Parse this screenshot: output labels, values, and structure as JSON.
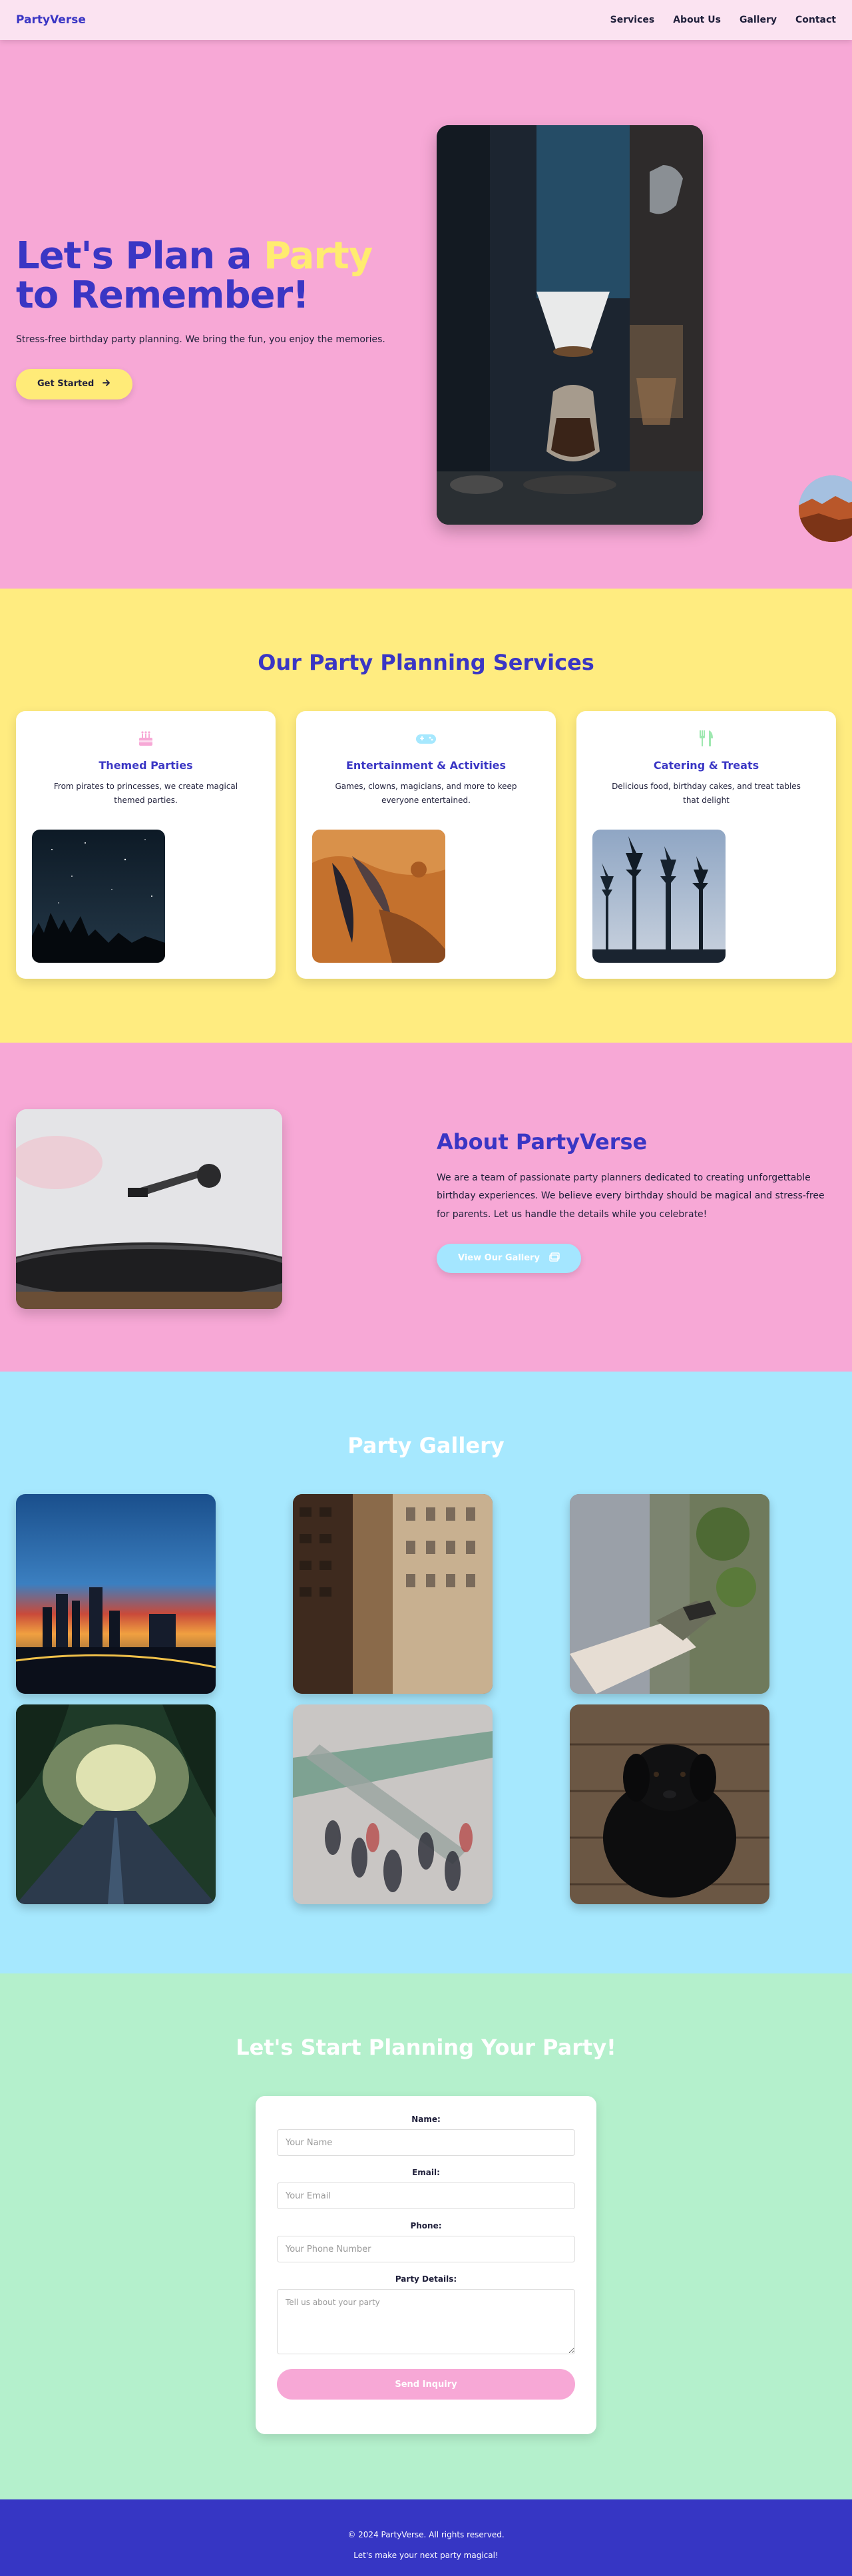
{
  "nav": {
    "logo": "PartyVerse",
    "links": [
      "Services",
      "About Us",
      "Gallery",
      "Contact"
    ]
  },
  "hero": {
    "title_part1": "Let's Plan a ",
    "title_highlight": "Party",
    "title_part2": " to Remember!",
    "subtitle": "Stress-free birthday party planning. We bring the fun, you enjoy the memories.",
    "cta_label": "Get Started",
    "cta_icon": "arrow-right-icon"
  },
  "services": {
    "title": "Our Party Planning Services",
    "items": [
      {
        "icon": "cake-icon",
        "title": "Themed Parties",
        "desc": "From pirates to princesses, we create magical themed parties."
      },
      {
        "icon": "gamepad-icon",
        "title": "Entertainment & Activities",
        "desc": "Games, clowns, magicians, and more to keep everyone entertained."
      },
      {
        "icon": "utensils-icon",
        "title": "Catering & Treats",
        "desc": "Delicious food, birthday cakes, and treat tables that delight"
      }
    ]
  },
  "about": {
    "title": "About PartyVerse",
    "body": "We are a team of passionate party planners dedicated to creating unforgettable birthday experiences. We believe every birthday should be magical and stress-free for parents. Let us handle the details while you celebrate!",
    "cta_label": "View Our Gallery",
    "cta_icon": "images-icon"
  },
  "gallery": {
    "title": "Party Gallery"
  },
  "contact": {
    "title": "Let's Start Planning Your Party!",
    "name_label": "Name:",
    "name_placeholder": "Your Name",
    "email_label": "Email:",
    "email_placeholder": "Your Email",
    "phone_label": "Phone:",
    "phone_placeholder": "Your Phone Number",
    "details_label": "Party Details:",
    "details_placeholder": "Tell us about your party",
    "submit_label": "Send Inquiry"
  },
  "footer": {
    "copyright": "© 2024 PartyVerse. All rights reserved.",
    "tagline": "Let's make your next party magical!"
  },
  "colors": {
    "primary": "#3a36c4",
    "pink": "#f7a8d6",
    "yellow": "#ffec80",
    "sky": "#a6e8fe",
    "mint": "#b4f0cc"
  }
}
